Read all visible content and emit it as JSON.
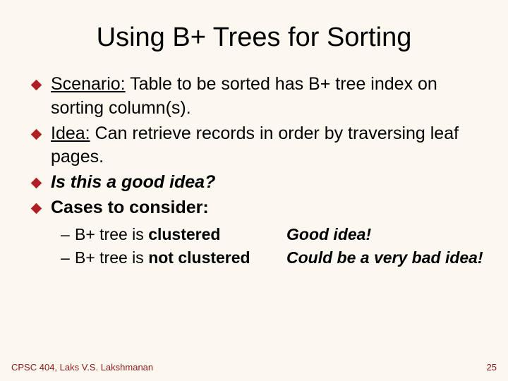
{
  "title": "Using B+ Trees for Sorting",
  "bullets": [
    {
      "prefix": "Scenario:",
      "text": " Table to be sorted has B+ tree index on sorting column(s).",
      "bold": false,
      "italic": false
    },
    {
      "prefix": "Idea:",
      "text": " Can retrieve records in order by traversing leaf pages.",
      "bold": false,
      "italic": false
    },
    {
      "prefix": "",
      "text": "Is this a good idea?",
      "bold": true,
      "italic": true
    },
    {
      "prefix": "",
      "text": "Cases to consider:",
      "bold": true,
      "italic": false
    }
  ],
  "sub": [
    {
      "left_pre": "B+ tree is ",
      "left_em": "clustered",
      "right": "Good idea!"
    },
    {
      "left_pre": "B+ tree is ",
      "left_em": "not clustered",
      "right": "Could be a very bad idea!"
    }
  ],
  "footer": {
    "left": "CPSC 404, Laks V.S. Lakshmanan",
    "right": "25"
  }
}
